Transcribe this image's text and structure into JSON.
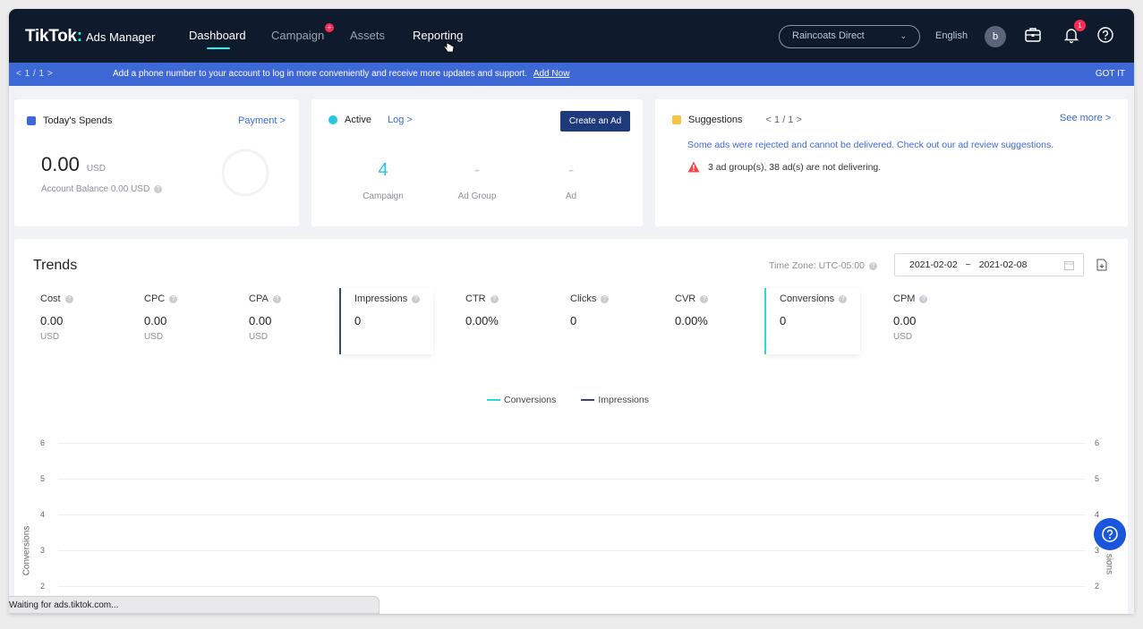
{
  "brand": {
    "logo": "TikTok",
    "colon": ":",
    "sub": "Ads Manager"
  },
  "nav": {
    "items": [
      "Dashboard",
      "Campaign",
      "Assets",
      "Reporting"
    ],
    "campaign_badge": "+"
  },
  "account": {
    "name": "Raincoats Direct"
  },
  "language": "English",
  "avatar_letter": "b",
  "notifications_count": "1",
  "banner": {
    "pager": "<   1  /  1    >",
    "message": "Add a phone number to your account to log in more conveniently and receive more updates and support.",
    "link": "Add Now",
    "dismiss": "GOT IT"
  },
  "spends": {
    "title": "Today's Spends",
    "payment_link": "Payment >",
    "amount": "0.00",
    "currency": "USD",
    "balance": "Account Balance 0.00 USD"
  },
  "active": {
    "title": "Active",
    "log_link": "Log >",
    "create_button": "Create an Ad",
    "stats": [
      {
        "value": "4",
        "label": "Campaign"
      },
      {
        "value": "-",
        "label": "Ad Group"
      },
      {
        "value": "-",
        "label": "Ad"
      }
    ]
  },
  "suggestions": {
    "title": "Suggestions",
    "pager": "< 1 / 1 >",
    "see_more": "See more >",
    "message": "Some ads were rejected and cannot be delivered. Check out our ad review suggestions.",
    "warning": "3 ad group(s), 38 ad(s) are not delivering."
  },
  "trends": {
    "title": "Trends",
    "timezone": "Time Zone: UTC-05:00",
    "date_start": "2021-02-02",
    "date_sep": "~",
    "date_end": "2021-02-08",
    "metrics": [
      {
        "label": "Cost",
        "value": "0.00",
        "unit": "USD"
      },
      {
        "label": "CPC",
        "value": "0.00",
        "unit": "USD"
      },
      {
        "label": "CPA",
        "value": "0.00",
        "unit": "USD"
      },
      {
        "label": "Impressions",
        "value": "0",
        "unit": ""
      },
      {
        "label": "CTR",
        "value": "0.00%",
        "unit": ""
      },
      {
        "label": "Clicks",
        "value": "0",
        "unit": ""
      },
      {
        "label": "CVR",
        "value": "0.00%",
        "unit": ""
      },
      {
        "label": "Conversions",
        "value": "0",
        "unit": ""
      },
      {
        "label": "CPM",
        "value": "0.00",
        "unit": "USD"
      }
    ],
    "legend": [
      "Conversions",
      "Impressions"
    ],
    "y_left_label": "Conversions",
    "y_right_label": "sions",
    "ticks": [
      "6",
      "5",
      "4",
      "3",
      "2"
    ]
  },
  "colors": {
    "nav_bg": "#0f1b2d",
    "accent_cyan": "#25f4ee",
    "banner_blue": "#3e68d6",
    "badge_red": "#fe2c55",
    "conversions_line": "#2bd9d9",
    "impressions_line": "#3b4660"
  },
  "status_text": "Waiting for ads.tiktok.com..."
}
